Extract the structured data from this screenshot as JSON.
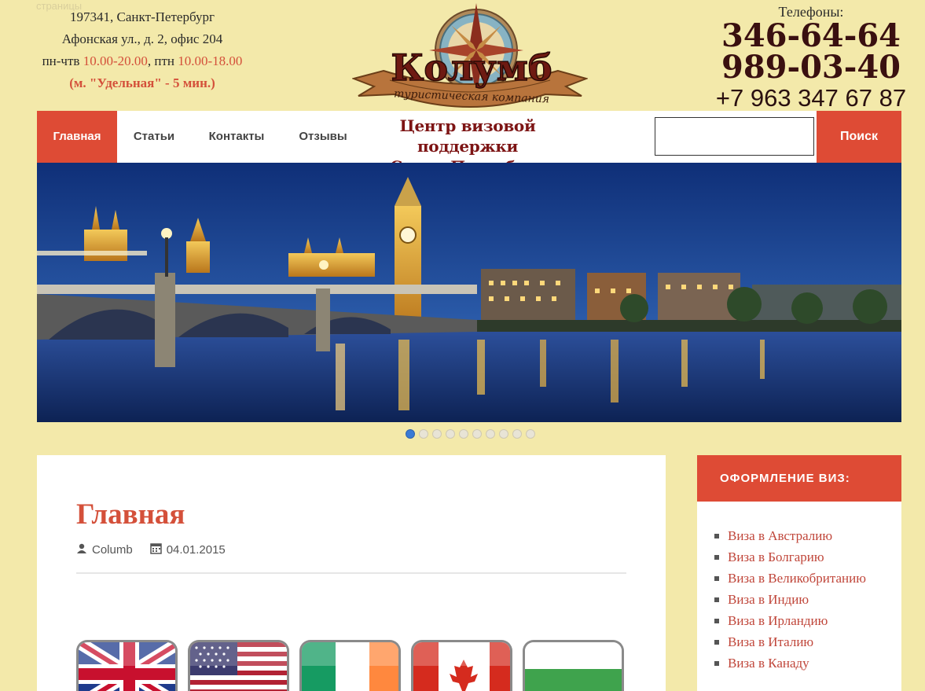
{
  "skip_link": "страницы",
  "address": {
    "line1": "197341, Санкт-Петербург",
    "line2": "Афонская ул., д. 2, офис 204",
    "hours_prefix": "пн-чтв ",
    "hours_weekday": "10.00-20.00",
    "hours_mid": ", птн ",
    "hours_friday": "10.00-18.00",
    "metro": "(м. \"Удельная\" - 5 мин.)"
  },
  "logo": {
    "name": "Колумб",
    "tagline": "туристическая компания"
  },
  "phones": {
    "label": "Телефоны:",
    "phone1": "346-64-64",
    "phone2": "989-03-40",
    "phone3": "+7 963 347 67 87"
  },
  "nav": {
    "items": [
      {
        "label": "Главная",
        "active": true
      },
      {
        "label": "Статьи"
      },
      {
        "label": "Контакты"
      },
      {
        "label": "Отзывы"
      }
    ],
    "center_title_1": "Центр визовой поддержки",
    "center_title_2": "Санкт-Петербург",
    "search_value": "",
    "search_button": "Поиск"
  },
  "slider": {
    "slide_count": 10,
    "active_index": 0
  },
  "article": {
    "title": "Главная",
    "author": "Columb",
    "date": "04.01.2015",
    "flags": [
      "uk-flag-icon",
      "usa-flag-icon",
      "ireland-flag-icon",
      "canada-flag-icon",
      "bulgaria-flag-icon"
    ]
  },
  "sidebar": {
    "heading": "ОФОРМЛЕНИЕ ВИЗ:",
    "items": [
      "Виза в Австралию",
      "Виза в Болгарию",
      "Виза в Великобританию",
      "Виза в Индию",
      "Виза в Ирландию",
      "Виза в Италию",
      "Виза в Канаду"
    ]
  },
  "colors": {
    "background": "#f3e9aa",
    "accent": "#de4b35",
    "title_red": "#7d1414",
    "phone_dark": "#3a1010"
  }
}
